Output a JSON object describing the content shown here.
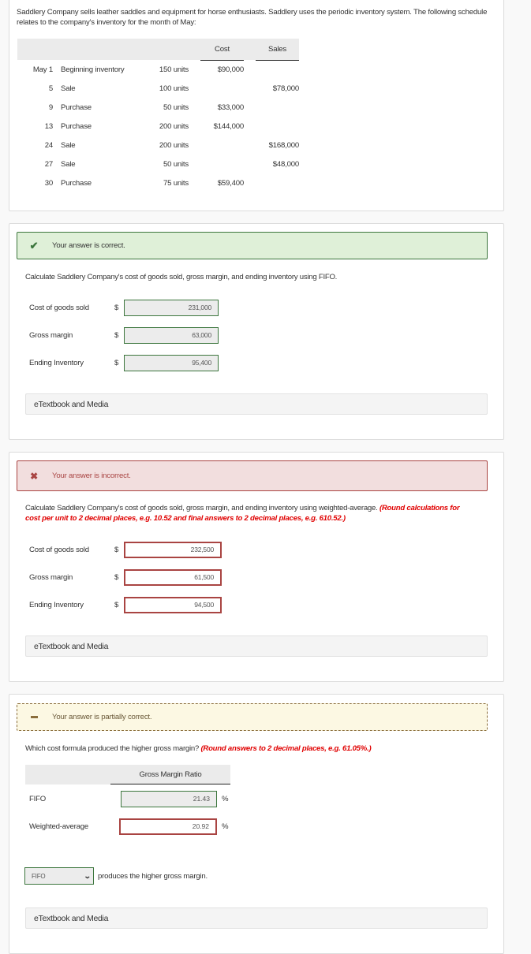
{
  "intro": "Saddlery Company sells leather saddles and equipment for horse enthusiasts. Saddlery uses the periodic inventory system. The following schedule relates to the company's inventory for the month of May:",
  "schedule": {
    "headers": {
      "cost": "Cost",
      "sales": "Sales"
    },
    "rows": [
      {
        "date": "May 1",
        "desc": "Beginning inventory",
        "units": "150 units",
        "cost": "$90,000",
        "sales": ""
      },
      {
        "date": "5",
        "desc": "Sale",
        "units": "100 units",
        "cost": "",
        "sales": "$78,000"
      },
      {
        "date": "9",
        "desc": "Purchase",
        "units": "50 units",
        "cost": "$33,000",
        "sales": ""
      },
      {
        "date": "13",
        "desc": "Purchase",
        "units": "200 units",
        "cost": "$144,000",
        "sales": ""
      },
      {
        "date": "24",
        "desc": "Sale",
        "units": "200 units",
        "cost": "",
        "sales": "$168,000"
      },
      {
        "date": "27",
        "desc": "Sale",
        "units": "50 units",
        "cost": "",
        "sales": "$48,000"
      },
      {
        "date": "30",
        "desc": "Purchase",
        "units": "75 units",
        "cost": "$59,400",
        "sales": ""
      }
    ]
  },
  "part_fifo": {
    "status": "Your answer is correct.",
    "status_icon": "check-icon",
    "question": "Calculate Saddlery Company's cost of goods sold, gross margin, and ending inventory using FIFO.",
    "fields": [
      {
        "label": "Cost of goods sold",
        "currency": "$",
        "value": "231,000",
        "state": "correct"
      },
      {
        "label": "Gross margin",
        "currency": "$",
        "value": "63,000",
        "state": "correct"
      },
      {
        "label": "Ending Inventory",
        "currency": "$",
        "value": "95,400",
        "state": "correct"
      }
    ],
    "media_label": "eTextbook and Media"
  },
  "part_wavg": {
    "status": "Your answer is incorrect.",
    "status_icon": "x-icon",
    "question": "Calculate Saddlery Company's cost of goods sold, gross margin, and ending inventory using weighted-average.",
    "hint": "(Round calculations for cost per unit to 2 decimal places, e.g. 10.52 and final answers to 2 decimal places, e.g. 610.52.)",
    "fields": [
      {
        "label": "Cost of goods sold",
        "currency": "$",
        "value": "232,500",
        "state": "incorrect"
      },
      {
        "label": "Gross margin",
        "currency": "$",
        "value": "61,500",
        "state": "incorrect"
      },
      {
        "label": "Ending Inventory",
        "currency": "$",
        "value": "94,500",
        "state": "incorrect"
      }
    ],
    "media_label": "eTextbook and Media"
  },
  "part_ratio": {
    "status": "Your answer is partially correct.",
    "status_icon": "minus-icon",
    "question": "Which cost formula produced the higher gross margin?",
    "hint": "(Round answers to 2 decimal places, e.g. 61.05%.)",
    "column_header": "Gross Margin Ratio",
    "rows": [
      {
        "label": "FIFO",
        "value": "21.43",
        "unit": "%",
        "state": "correct"
      },
      {
        "label": "Weighted-average",
        "value": "20.92",
        "unit": "%",
        "state": "incorrect"
      }
    ],
    "select_value": "FIFO",
    "select_suffix": "produces the higher gross margin.",
    "media_label": "eTextbook and Media"
  },
  "colors": {
    "correct": "#3c763d",
    "correct_bg": "#dff0d8",
    "incorrect": "#a94442",
    "incorrect_bg": "#f2dede",
    "partial": "#8a6d3b",
    "partial_bg": "#fcf8e3",
    "hint": "#e00000"
  }
}
